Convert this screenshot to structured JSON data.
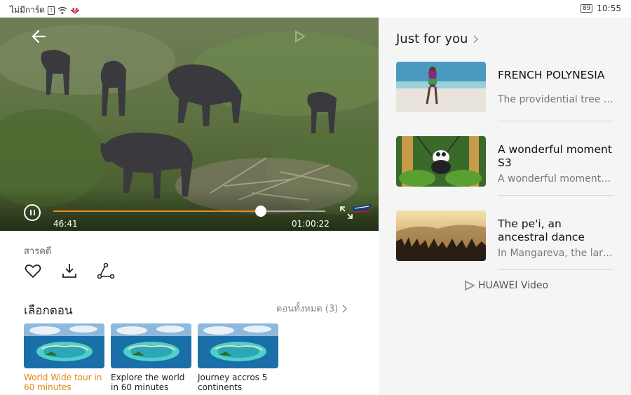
{
  "status_bar": {
    "carrier": "ไม่มีการ์ด",
    "battery": "89",
    "time": "10:55"
  },
  "player": {
    "current_time": "46:41",
    "duration": "01:00:22",
    "progress_fraction": 0.764
  },
  "info": {
    "category": "สารคดี",
    "actions": [
      "heart-icon",
      "download-icon",
      "share-icon"
    ],
    "episodes_title": "เลือกตอน",
    "all_episodes": "ตอนทั้งหมด (3)",
    "episodes": [
      {
        "label": "World Wide tour in 60 minutes",
        "active": true
      },
      {
        "label": "Explore the world in 60 minutes",
        "active": false
      },
      {
        "label": "Journey accros 5 continents",
        "active": false
      }
    ]
  },
  "sidebar": {
    "heading": "Just for you",
    "items": [
      {
        "title": "FRENCH POLYNESIA",
        "desc": "The providential tree of..."
      },
      {
        "title": "A wonderful moment S3",
        "desc": "A wonderful moment S3"
      },
      {
        "title": "The pe'i, an ancestral dance",
        "desc": "In Mangareva, the larg..."
      }
    ],
    "footer_brand": "HUAWEI Video"
  },
  "colors": {
    "accent": "#f08a1c",
    "active_episode": "#e8860f"
  }
}
